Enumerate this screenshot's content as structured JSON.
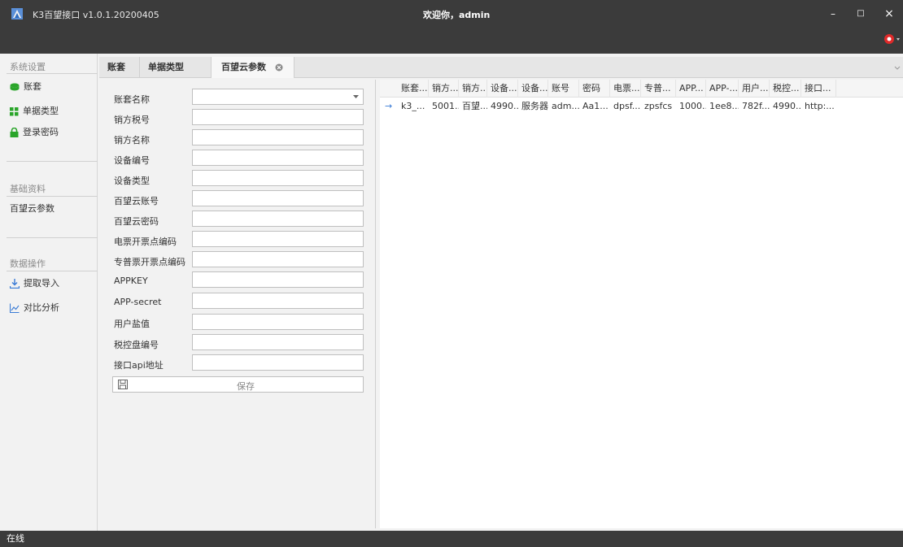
{
  "window": {
    "title": "K3百望接口 v1.0.1.20200405",
    "welcome": "欢迎你，admin",
    "minimize_glyph": "–",
    "maximize_glyph": "□",
    "close_glyph": "×"
  },
  "sidebar": {
    "groups": [
      {
        "label": "系统设置",
        "items": [
          {
            "label": "账套",
            "icon": "database-icon"
          },
          {
            "label": "单据类型",
            "icon": "grid-icon"
          },
          {
            "label": "登录密码",
            "icon": "lock-icon"
          }
        ]
      },
      {
        "label": "基础资料",
        "items": [
          {
            "label": "百望云参数",
            "icon": ""
          }
        ]
      },
      {
        "label": "数据操作",
        "items": [
          {
            "label": "提取导入",
            "icon": "import-icon"
          },
          {
            "label": "对比分析",
            "icon": "chart-icon"
          }
        ]
      }
    ]
  },
  "tabs": [
    {
      "label": "账套"
    },
    {
      "label": "单据类型"
    },
    {
      "label": "百望云参数"
    }
  ],
  "form": {
    "fields": [
      {
        "label": "账套名称",
        "value": ""
      },
      {
        "label": "销方税号",
        "value": ""
      },
      {
        "label": "销方名称",
        "value": ""
      },
      {
        "label": "设备编号",
        "value": ""
      },
      {
        "label": "设备类型",
        "value": ""
      },
      {
        "label": "百望云账号",
        "value": ""
      },
      {
        "label": "百望云密码",
        "value": ""
      },
      {
        "label": "电票开票点编码",
        "value": ""
      },
      {
        "label": "专普票开票点编码",
        "value": ""
      },
      {
        "label": "APPKEY",
        "value": ""
      },
      {
        "label": "APP-secret",
        "value": ""
      },
      {
        "label": "用户盐值",
        "value": ""
      },
      {
        "label": "税控盘编号",
        "value": ""
      },
      {
        "label": "接口api地址",
        "value": ""
      }
    ],
    "save_label": "保存"
  },
  "grid": {
    "columns": [
      "账套...",
      "销方...",
      "销方...",
      "设备...",
      "设备...",
      "账号",
      "密码",
      "电票...",
      "专普...",
      "APP...",
      "APP-...",
      "用户...",
      "税控...",
      "接口..."
    ],
    "rows": [
      [
        "k3_...",
        "5001...",
        "百望...",
        "4990...",
        "服务器",
        "adm...",
        "Aa1...",
        "dpsf...",
        "zpsfcs",
        "1000...",
        "1ee8...",
        "782f...",
        "4990...",
        "http:..."
      ]
    ],
    "current_row_marker": "→"
  },
  "status": {
    "text": "在线"
  },
  "colors": {
    "titlebar": "#3b3b3b",
    "accent_green": "#2aa52a",
    "skin_red": "#e02a2a"
  }
}
